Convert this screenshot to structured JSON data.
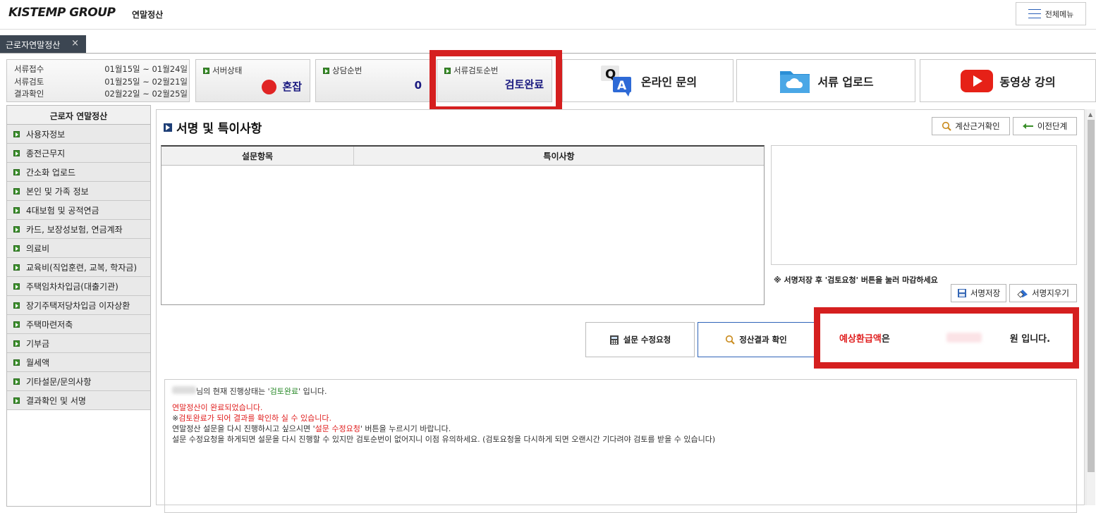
{
  "header": {
    "logo": "KISTEMP GROUP",
    "app_title": "연말정산",
    "all_menu_label": "전체메뉴"
  },
  "tab": {
    "label": "근로자연말정산",
    "close": "×"
  },
  "schedule": [
    {
      "label": "서류접수",
      "period": "01월15일 ~ 01월24일"
    },
    {
      "label": "서류검토",
      "period": "01월25일 ~ 02월21일"
    },
    {
      "label": "결과확인",
      "period": "02월22일 ~ 02월25일"
    }
  ],
  "status_panels": {
    "server_label": "서버상태",
    "server_value": "혼잡",
    "consult_label": "상담순번",
    "consult_value": "0",
    "review_label": "서류검토순번",
    "review_value": "검토완료"
  },
  "quick_links": {
    "online_inquiry": "온라인 문의",
    "doc_upload": "서류 업로드",
    "video_lecture": "동영상 강의"
  },
  "sidebar": {
    "title": "근로자 연말정산",
    "items": [
      "사용자정보",
      "종전근무지",
      "간소화 업로드",
      "본인 및 가족 정보",
      "4대보험 및 공적연금",
      "카드, 보장성보험, 연금계좌",
      "의료비",
      "교육비(직업훈련, 교복, 학자금)",
      "주택임차차입금(대출기관)",
      "장기주택저당차입금 이자상환",
      "주택마련저축",
      "기부금",
      "월세액",
      "기타설문/문의사항",
      "결과확인 및 서명"
    ]
  },
  "main": {
    "section_title": "서명 및 특이사항",
    "calc_basis_btn": "계산근거확인",
    "prev_step_btn": "이전단계",
    "table_headers": [
      "설문항목",
      "특이사항"
    ],
    "sign_note": "※ 서명저장 후 '검토요청' 버튼을 눌러 마감하세요",
    "sign_save_btn": "서명저장",
    "sign_clear_btn": "서명지우기",
    "survey_edit_btn": "설문 수정요청",
    "settlement_check_btn": "정산결과 확인",
    "refund_label": "예상환급액",
    "refund_suffix1": "은",
    "refund_suffix2": "원 입니다."
  },
  "message": {
    "line1_a": "님의 현재 진행상태는 '",
    "line1_status": "검토완료",
    "line1_b": "' 입니다.",
    "line2": "연말정산이 완료되었습니다.",
    "line3_a": "※",
    "line3_b": "검토완료가 되어 결과를 확인하 실 수 있습니다.",
    "line4_a": "연말정산 설문을 다시 진행하시고 싶으시면 '",
    "line4_b": "설문 수정요청",
    "line4_c": "' 버튼을 누르시기 바랍니다.",
    "line5": "설문 수정요청을 하게되면 설문을 다시 진행할 수 있지만 검토순번이 없어지니 이점 유의하세요. (검토요청을 다시하게 되면 오랜시간 기다려야 검토를 받을 수 있습니다)"
  },
  "colors": {
    "highlight_red": "#d51f1f",
    "status_red": "#e02424",
    "brand_navy": "#1a1a80",
    "sidebar_bullet_green": "#3a8f2a"
  }
}
